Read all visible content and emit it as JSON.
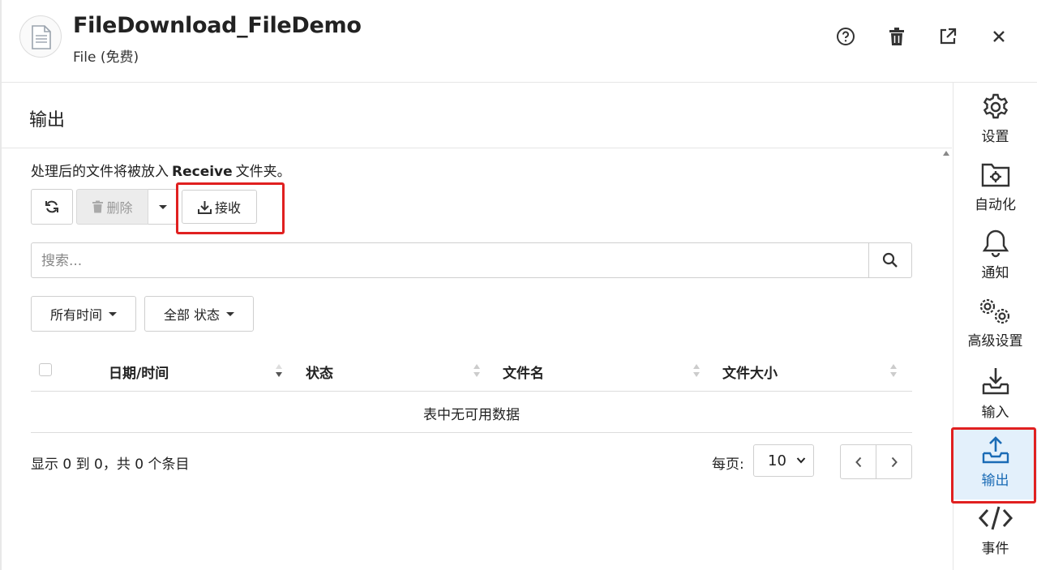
{
  "header": {
    "title": "FileDownload_FileDemo",
    "subtitle": "File (免费)",
    "icons": [
      "file-icon",
      "help-icon",
      "trash-icon",
      "external-link-icon",
      "close-icon"
    ]
  },
  "panel": {
    "title": "输出",
    "description_prefix": "处理后的文件将被放入",
    "description_folder": "Receive",
    "description_suffix": "文件夹。"
  },
  "toolbar": {
    "refresh_icon": "refresh-icon",
    "delete_label": "删除",
    "receive_label": "接收"
  },
  "search": {
    "placeholder": "搜索...",
    "value": ""
  },
  "filters": {
    "time_label": "所有时间",
    "status_label": "全部 状态"
  },
  "table": {
    "columns": [
      "日期/时间",
      "状态",
      "文件名",
      "文件大小"
    ],
    "empty_text": "表中无可用数据"
  },
  "pagination": {
    "info": "显示 0 到 0，共 0 个条目",
    "per_page_label": "每页:",
    "per_page_value": "10"
  },
  "sidebar": {
    "items": [
      {
        "label": "设置",
        "icon": "gear-icon",
        "active": false
      },
      {
        "label": "自动化",
        "icon": "folder-gear-icon",
        "active": false
      },
      {
        "label": "通知",
        "icon": "bell-icon",
        "active": false
      },
      {
        "label": "高级设置",
        "icon": "gears-icon",
        "active": false
      },
      {
        "label": "输入",
        "icon": "inbox-download-icon",
        "active": false
      },
      {
        "label": "输出",
        "icon": "inbox-upload-icon",
        "active": true
      },
      {
        "label": "事件",
        "icon": "code-icon",
        "active": false
      }
    ]
  },
  "colors": {
    "accent": "#1a6bb5",
    "highlight_box": "#e02020",
    "active_bg": "#e3f0fb"
  }
}
